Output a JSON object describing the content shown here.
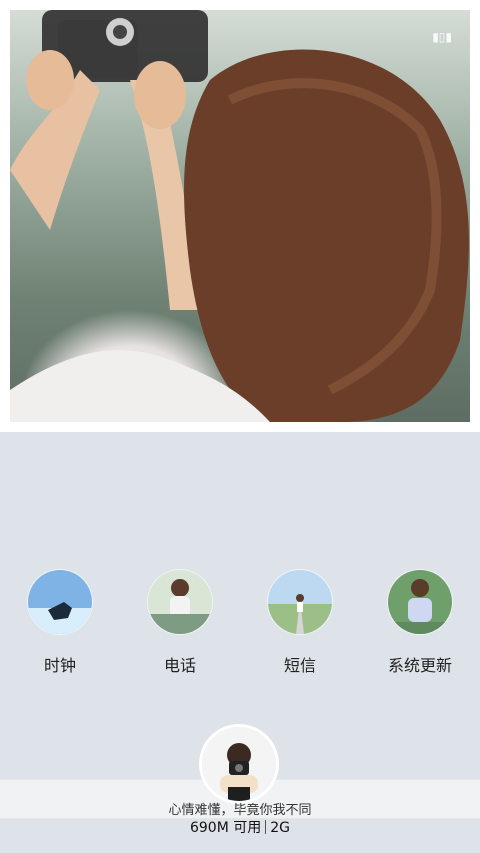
{
  "apps": [
    {
      "label": "时钟"
    },
    {
      "label": "电话"
    },
    {
      "label": "短信"
    },
    {
      "label": "系统更新"
    }
  ],
  "footer": {
    "tagline": "心情难懂，毕竟你我不同",
    "memory": "690M 可用",
    "network": "2G"
  },
  "icons": {
    "signal": "signal-icon"
  }
}
